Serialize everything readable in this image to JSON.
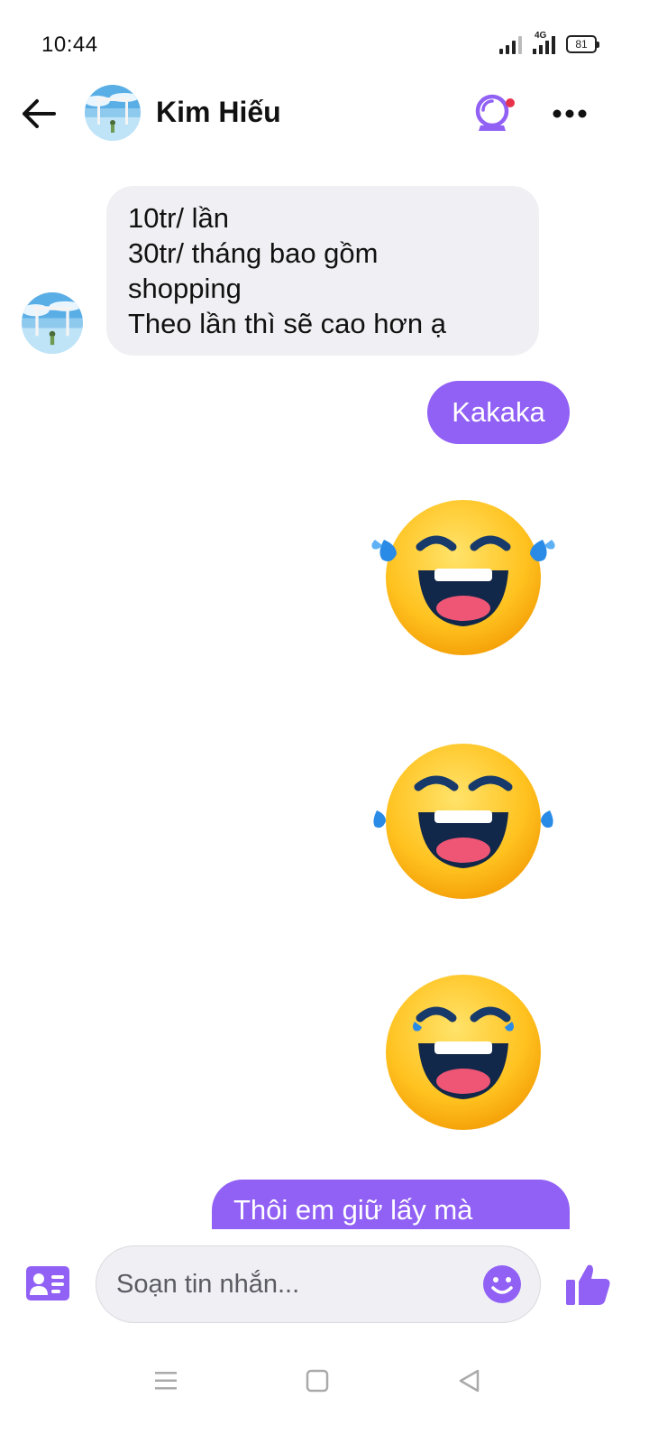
{
  "status_bar": {
    "time": "10:44",
    "network": "4G",
    "battery": "81"
  },
  "header": {
    "contact_name": "Kim Hiếu"
  },
  "messages": {
    "incoming": {
      "lines": [
        "10tr/ lần",
        "30tr/ tháng bao gồm",
        "shopping",
        "Theo lần thì sẽ cao hơn ạ"
      ]
    },
    "outgoing_1": "Kakaka",
    "stickers": [
      "laughing-tears-emoji",
      "laughing-tears-emoji",
      "laughing-tears-emoji"
    ],
    "outgoing_2": "Thôi em giữ lấy mà"
  },
  "composer": {
    "placeholder": "Soạn tin nhắn..."
  },
  "colors": {
    "accent": "#9160f5",
    "incoming_bubble": "#f0f0f4",
    "notification_dot": "#e8334d"
  },
  "icons": {
    "back": "arrow-left-icon",
    "header_action": "crystal-ball-icon",
    "more": "more-horizontal-icon",
    "contact_card": "contact-card-icon",
    "emoji": "smiley-icon",
    "like": "thumbs-up-icon"
  }
}
